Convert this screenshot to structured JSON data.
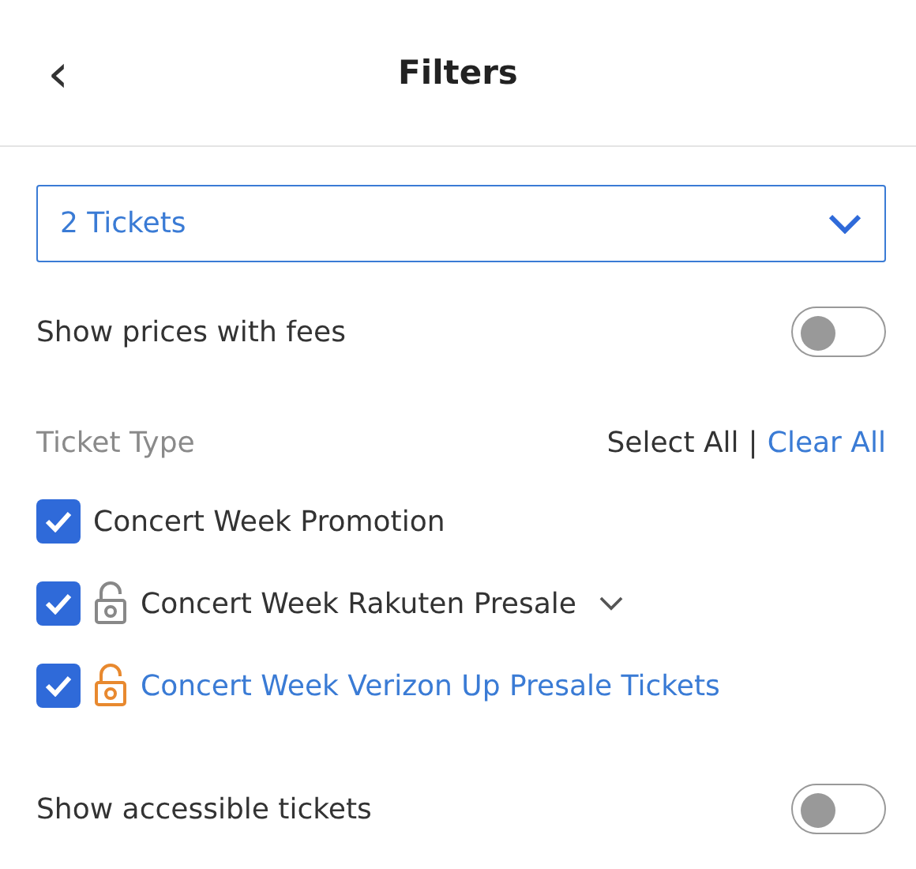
{
  "header": {
    "back_icon": "‹",
    "title": "Filters"
  },
  "quantity_select": {
    "value": "2 Tickets"
  },
  "fees_toggle": {
    "label": "Show prices with fees",
    "on": false
  },
  "ticket_type": {
    "heading": "Ticket Type",
    "select_all": "Select All",
    "separator": "|",
    "clear_all": "Clear All",
    "options": [
      {
        "kind": "plain",
        "label": "Concert Week Promotion",
        "checked": true
      },
      {
        "kind": "locked",
        "label": "Concert Week Rakuten Presale",
        "checked": true
      },
      {
        "kind": "featured",
        "label": "Concert Week Verizon Up Presale Tickets",
        "checked": true
      }
    ]
  },
  "accessible_toggle": {
    "label": "Show accessible tickets",
    "on": false
  }
}
